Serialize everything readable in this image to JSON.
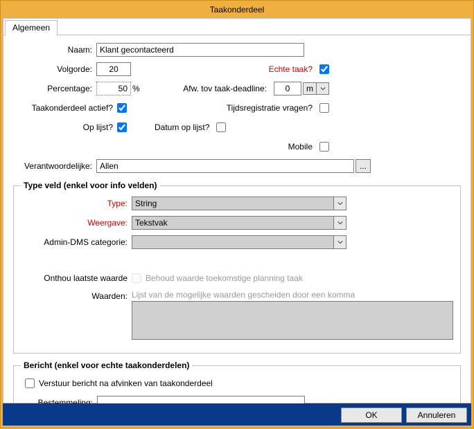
{
  "window": {
    "title": "Taakonderdeel"
  },
  "tabs": {
    "general": "Algemeen"
  },
  "labels": {
    "naam": "Naam:",
    "volgorde": "Volgorde:",
    "echte_taak": "Echte taak?",
    "percentage": "Percentage:",
    "percent_sign": "%",
    "afw_deadline": "Afw. tov taak-deadline:",
    "unit_m": "m",
    "actief": "Taakonderdeel actief?",
    "tijdsregistratie": "Tijdsregistratie vragen?",
    "op_lijst": "Op lijst?",
    "datum_op_lijst": "Datum op lijst?",
    "mobile": "Mobile",
    "verantwoordelijke": "Verantwoordelijke:",
    "browse": "...",
    "typeveld_legend": "Type veld (enkel voor info velden)",
    "type": "Type:",
    "weergave": "Weergave:",
    "admin_dms": "Admin-DMS categorie:",
    "onthou": "Onthou laatste waarde",
    "behoud": "Behoud waarde toekomstige planning taak",
    "waarden": "Waarden:",
    "waarden_placeholder": "Lijst van de mogelijke waarden gescheiden door een komma",
    "bericht_legend": "Bericht (enkel voor echte taakonderdelen)",
    "verstuur": "Verstuur bericht na afvinken van taakonderdeel",
    "bestemmeling": "Bestemmeling:"
  },
  "values": {
    "naam": "Klant gecontacteerd",
    "volgorde": "20",
    "echte_taak": true,
    "percentage": "50",
    "afw_deadline": "0",
    "actief": true,
    "tijdsregistratie": false,
    "op_lijst": true,
    "datum_op_lijst": false,
    "mobile": false,
    "verantwoordelijke": "Allen",
    "type": "String",
    "weergave": "Tekstvak",
    "admin_dms": "",
    "onthou": false,
    "behoud": false,
    "waarden": "",
    "verstuur": false,
    "bestemmeling": ""
  },
  "buttons": {
    "ok": "OK",
    "cancel": "Annuleren"
  }
}
